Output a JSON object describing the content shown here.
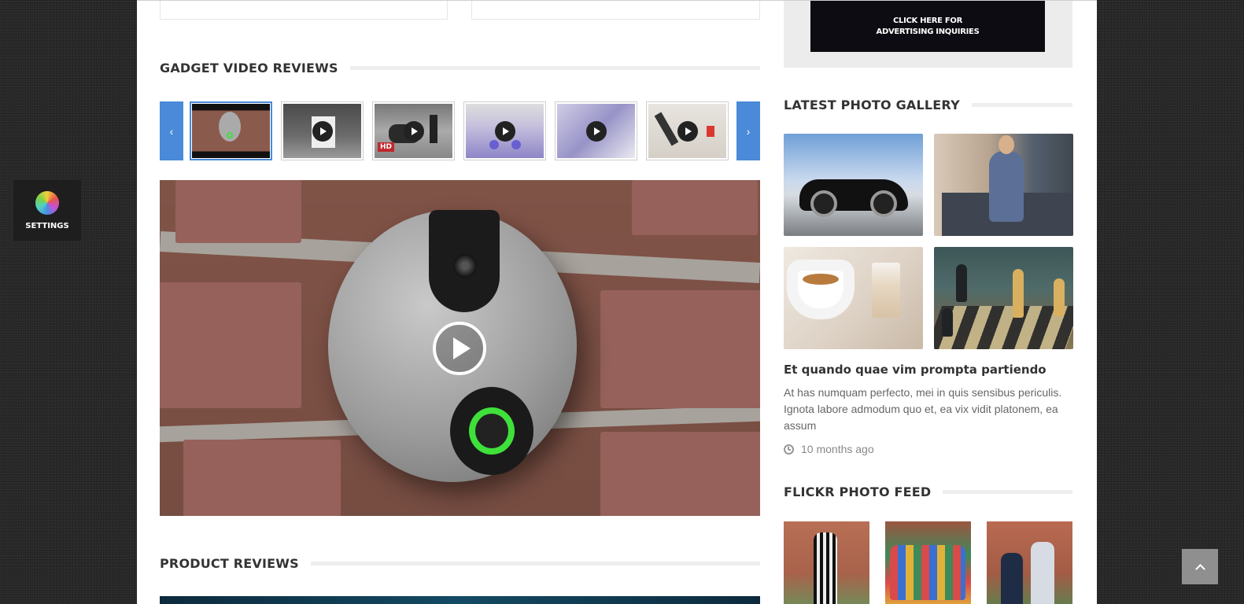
{
  "video_reviews": {
    "title": "GADGET VIDEO REVIEWS",
    "prev_icon": "chevron-left-icon",
    "next_icon": "chevron-right-icon",
    "prev_glyph": "‹",
    "next_glyph": "›",
    "hd_badge": "HD",
    "thumbnails": [
      "doorbell",
      "washing-machine",
      "motorcycle",
      "car-interior-purple",
      "car-dashboard",
      "desk-phone"
    ],
    "active_index": 0,
    "accent_color": "#4a8ad8"
  },
  "product_reviews": {
    "title": "PRODUCT REVIEWS"
  },
  "ad": {
    "line1": "CLICK HERE FOR",
    "line2": "ADVERTISING INQUIRIES"
  },
  "gallery": {
    "title": "LATEST PHOTO GALLERY",
    "post_title": "Et quando quae vim prompta partiendo",
    "excerpt": "At has numquam perfecto, mei in quis sensibus periculis. Ignota labore admodum quo et, ea vix vidit platonem, ea assum",
    "time": "10 months ago"
  },
  "flickr": {
    "title": "FLICKR PHOTO FEED"
  },
  "settings": {
    "label": "SETTINGS"
  }
}
